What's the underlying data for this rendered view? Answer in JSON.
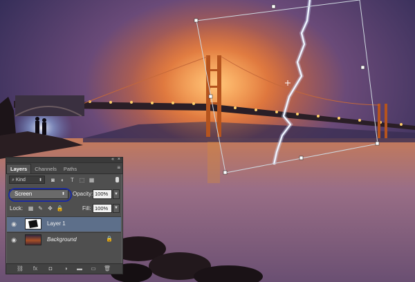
{
  "scene": {
    "description_icon": "bridge-photo-canvas",
    "colors": {
      "glow": "#ff9a2a",
      "sky": "#2b2b55",
      "water": "#8a6a86",
      "transform": "#cfd8e0"
    }
  },
  "panel": {
    "collapse_icon": "«",
    "close_icon": "×",
    "tabs": [
      {
        "label": "Layers"
      },
      {
        "label": "Channels"
      },
      {
        "label": "Paths"
      }
    ],
    "menu_icon": "≡",
    "filter": {
      "kind_label": "Kind",
      "search_icon": "⌕",
      "icons": [
        "◙",
        "◐",
        "T",
        "⬚",
        "▦"
      ]
    },
    "blend_mode": "Screen",
    "opacity_label": "Opacity:",
    "opacity_value": "100%",
    "lock_label": "Lock:",
    "lock_icons": [
      "▦",
      "✎",
      "✥",
      "🔒"
    ],
    "fill_label": "Fill:",
    "fill_value": "100%",
    "layers": [
      {
        "name": "Layer 1",
        "selected": true
      },
      {
        "name": "Background",
        "selected": false,
        "locked": true
      }
    ],
    "bottom_icons": [
      "⛓",
      "fx",
      "◘",
      "◑",
      "▬",
      "▭",
      "🗑"
    ]
  }
}
